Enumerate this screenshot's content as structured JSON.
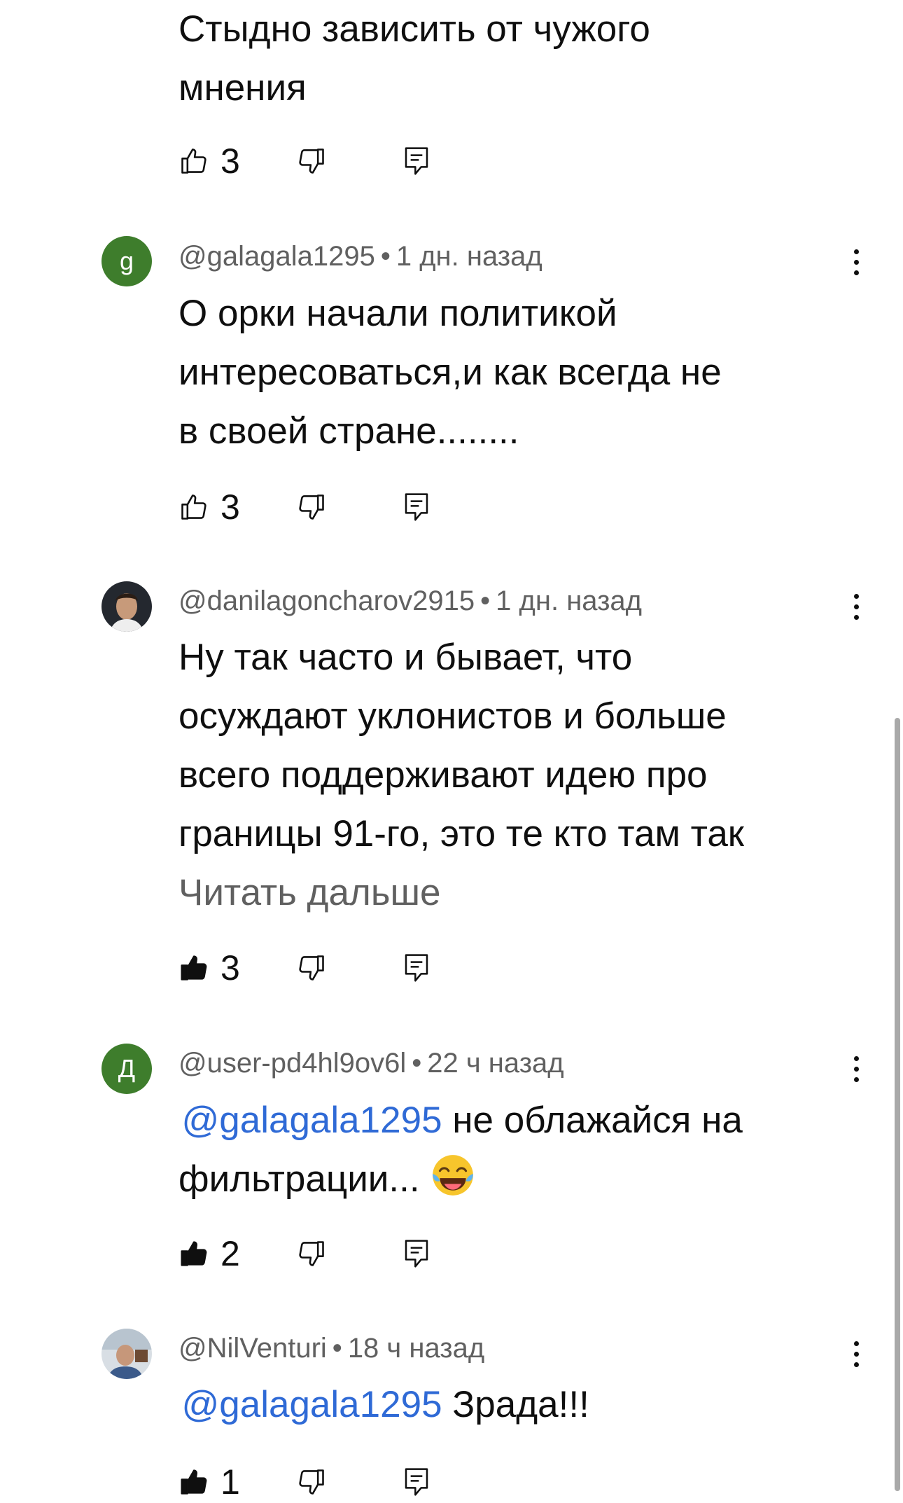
{
  "comments": [
    {
      "text_lines": [
        "Стыдно зависить от чужого",
        "мнения"
      ],
      "likes": "3"
    },
    {
      "avatar_letter": "g",
      "avatar_color": "#3e7d2c",
      "handle": "@galagala1295",
      "time": "1 дн. назад",
      "text_lines": [
        "О орки начали политикой",
        "интересоваться,и как всегда не",
        "в своей стране........"
      ],
      "likes": "3"
    },
    {
      "avatar_icon": "user-photo-avatar",
      "handle": "@danilagoncharov2915",
      "time": "1 дн. назад",
      "text_lines": [
        "Ну так часто и бывает, что",
        "осуждают уклонистов и больше",
        "всего поддерживают идею про",
        "границы 91-го, это те кто там так"
      ],
      "read_more": "Читать дальше",
      "likes": "3"
    },
    {
      "avatar_letter": "Д",
      "avatar_color": "#3e7d2c",
      "handle": "@user-pd4hl9ov6l",
      "time": "22 ч назад",
      "mention": "@galagala1295",
      "line1_rest": " не облажайся на",
      "line2": "фильтрации...",
      "emoji": "face-with-tears-of-joy-emoji",
      "likes": "2"
    },
    {
      "avatar_icon": "user-photo-avatar",
      "handle": "@NilVenturi",
      "time": "18 ч назад",
      "mention": "@galagala1295",
      "line1_rest": " Зрада!!!",
      "likes": "1"
    }
  ],
  "separator": "•",
  "colors": {
    "mention": "#2f6ad6",
    "meta": "#606060",
    "text": "#0f0f0f",
    "avatar_green": "#3e7d2c"
  }
}
